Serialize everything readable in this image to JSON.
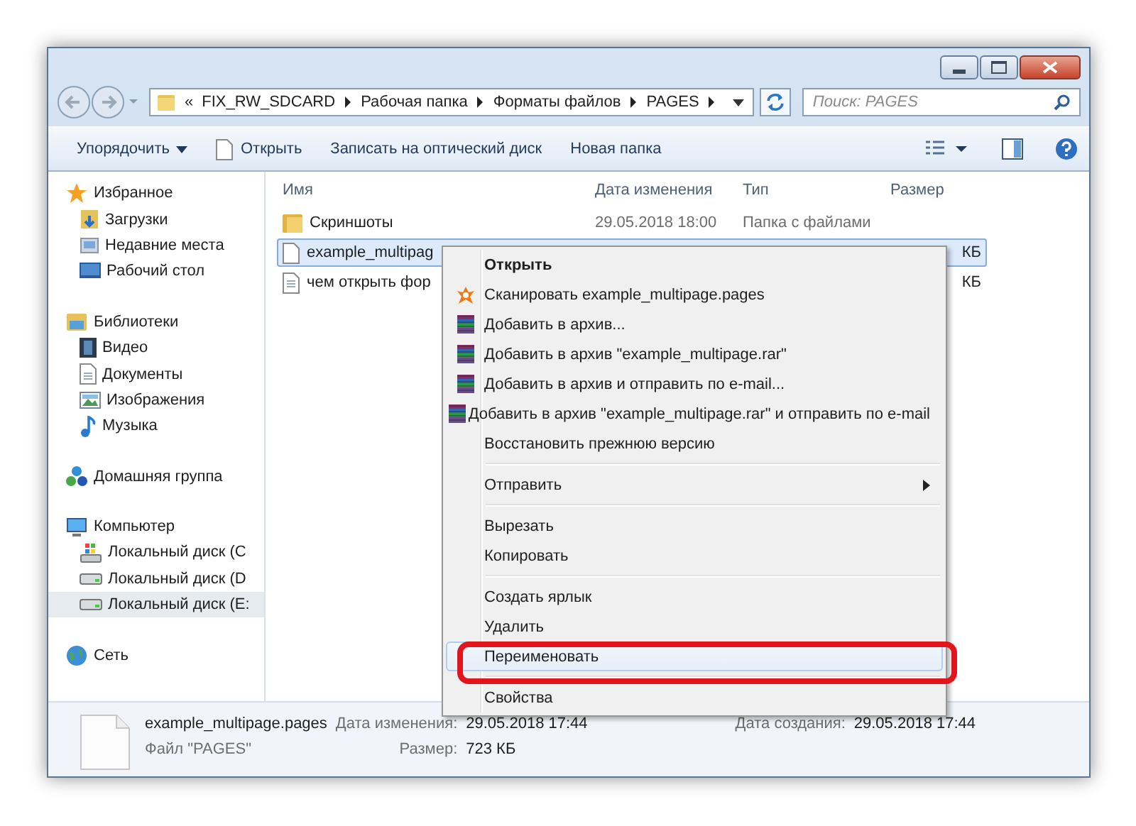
{
  "address": {
    "overflow": "«",
    "crumbs": [
      "FIX_RW_SDCARD",
      "Рабочая папка",
      "Форматы файлов",
      "PAGES"
    ]
  },
  "search": {
    "placeholder": "Поиск: PAGES"
  },
  "toolbar": [
    {
      "label": "Упорядочить",
      "kind": "dropdown"
    },
    {
      "label": "Открыть",
      "kind": "file"
    },
    {
      "label": "Записать на оптический диск",
      "kind": "plain"
    },
    {
      "label": "Новая папка",
      "kind": "plain"
    }
  ],
  "nav": [
    {
      "label": "Избранное",
      "selected": false,
      "children": [
        {
          "label": "Загрузки",
          "selected": false
        },
        {
          "label": "Недавние места",
          "selected": false
        },
        {
          "label": "Рабочий стол",
          "selected": false
        }
      ]
    },
    {
      "label": "Библиотеки",
      "selected": false,
      "children": [
        {
          "label": "Видео",
          "selected": false
        },
        {
          "label": "Документы",
          "selected": false
        },
        {
          "label": "Изображения",
          "selected": false
        },
        {
          "label": "Музыка",
          "selected": false
        }
      ]
    },
    {
      "label": "Домашняя группа",
      "selected": false
    },
    {
      "label": "Компьютер",
      "selected": false,
      "children": [
        {
          "label": "Локальный диск (C",
          "selected": false
        },
        {
          "label": "Локальный диск (D",
          "selected": false
        },
        {
          "label": "Локальный диск (E:",
          "selected": true
        }
      ]
    },
    {
      "label": "Сеть",
      "selected": false
    }
  ],
  "columns": [
    "Имя",
    "Дата изменения",
    "Тип",
    "Размер"
  ],
  "files": [
    {
      "kind": "folder",
      "name": "Скриншоты",
      "date": "29.05.2018 18:00",
      "type": "Папка с файлами",
      "selected": false
    },
    {
      "kind": "file",
      "name": "example_multipag",
      "size": "КБ",
      "selected": true
    },
    {
      "kind": "doc",
      "name": "чем открыть фор",
      "size": "КБ",
      "selected": false
    }
  ],
  "context_menu": [
    [
      {
        "label": "Открыть",
        "kind": "default",
        "selected": false,
        "highlighted": false
      },
      {
        "label": "Сканировать example_multipage.pages",
        "kind": "scan",
        "selected": false,
        "highlighted": false
      },
      {
        "label": "Добавить в архив...",
        "kind": "archive",
        "selected": false,
        "highlighted": false
      },
      {
        "label": "Добавить в архив \"example_multipage.rar\"",
        "kind": "archive",
        "selected": false,
        "highlighted": false
      },
      {
        "label": "Добавить в архив и отправить по e-mail...",
        "kind": "archive",
        "selected": false,
        "highlighted": false
      },
      {
        "label": "Добавить в архив \"example_multipage.rar\" и отправить по e-mail",
        "kind": "archive",
        "selected": false,
        "highlighted": false
      },
      {
        "label": "Восстановить прежнюю версию",
        "kind": "normal",
        "selected": false,
        "highlighted": false
      }
    ],
    [
      {
        "label": "Отправить",
        "kind": "submenu",
        "selected": false,
        "highlighted": false
      }
    ],
    [
      {
        "label": "Вырезать",
        "kind": "normal",
        "selected": false,
        "highlighted": false
      },
      {
        "label": "Копировать",
        "kind": "normal",
        "selected": false,
        "highlighted": false
      }
    ],
    [
      {
        "label": "Создать ярлык",
        "kind": "normal",
        "selected": false,
        "highlighted": false
      },
      {
        "label": "Удалить",
        "kind": "normal",
        "selected": false,
        "highlighted": false
      },
      {
        "label": "Переименовать",
        "kind": "normal",
        "selected": true,
        "highlighted": true
      }
    ],
    [
      {
        "label": "Свойства",
        "kind": "normal",
        "selected": false,
        "highlighted": false
      }
    ]
  ],
  "details": {
    "name": "example_multipage.pages",
    "type": "Файл \"PAGES\"",
    "fields": [
      {
        "label": "Дата изменения:",
        "value": "29.05.2018 17:44"
      },
      {
        "label": "Размер:",
        "value": "723 КБ"
      },
      {
        "label": "Дата создания:",
        "value": "29.05.2018 17:44"
      }
    ]
  }
}
